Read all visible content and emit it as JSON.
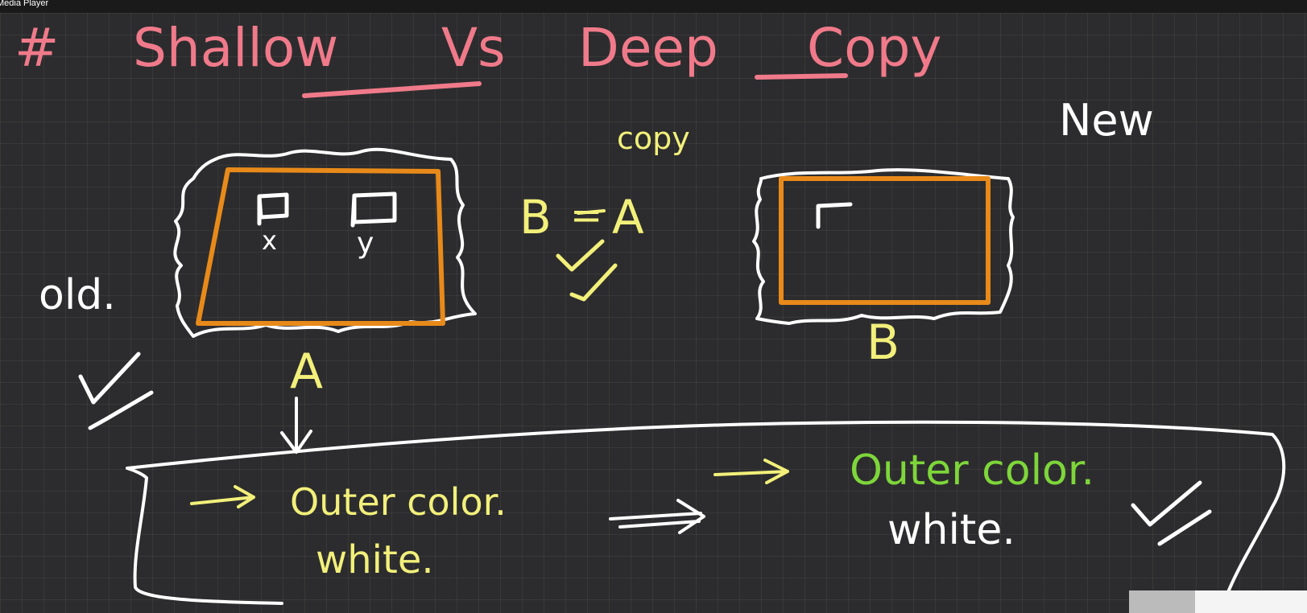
{
  "window": {
    "title": "Media Player"
  },
  "board": {
    "heading_hash": "#",
    "heading_word1": "Shallow",
    "heading_word2": "Vs",
    "heading_word3": "Deep",
    "heading_word4": "Copy",
    "label_new": "New",
    "label_copy": "copy",
    "label_b_eq_a_b": "B",
    "label_b_eq_a_eq": "=",
    "label_b_eq_a_a": "A",
    "label_old": "old.",
    "obj_a_field_x": "x",
    "obj_a_field_y": "y",
    "obj_a_label": "A",
    "obj_b_label": "B",
    "note_left_line1": "Outer color.",
    "note_left_line2": "white.",
    "note_right_line1": "Outer color.",
    "note_right_line2": "white."
  },
  "colors": {
    "background": "#2c2c2e",
    "heading": "#f07a8a",
    "white_ink": "#ffffff",
    "yellow_ink": "#f2f07a",
    "orange_box": "#e88a1a",
    "green_ink": "#7ed63a"
  }
}
